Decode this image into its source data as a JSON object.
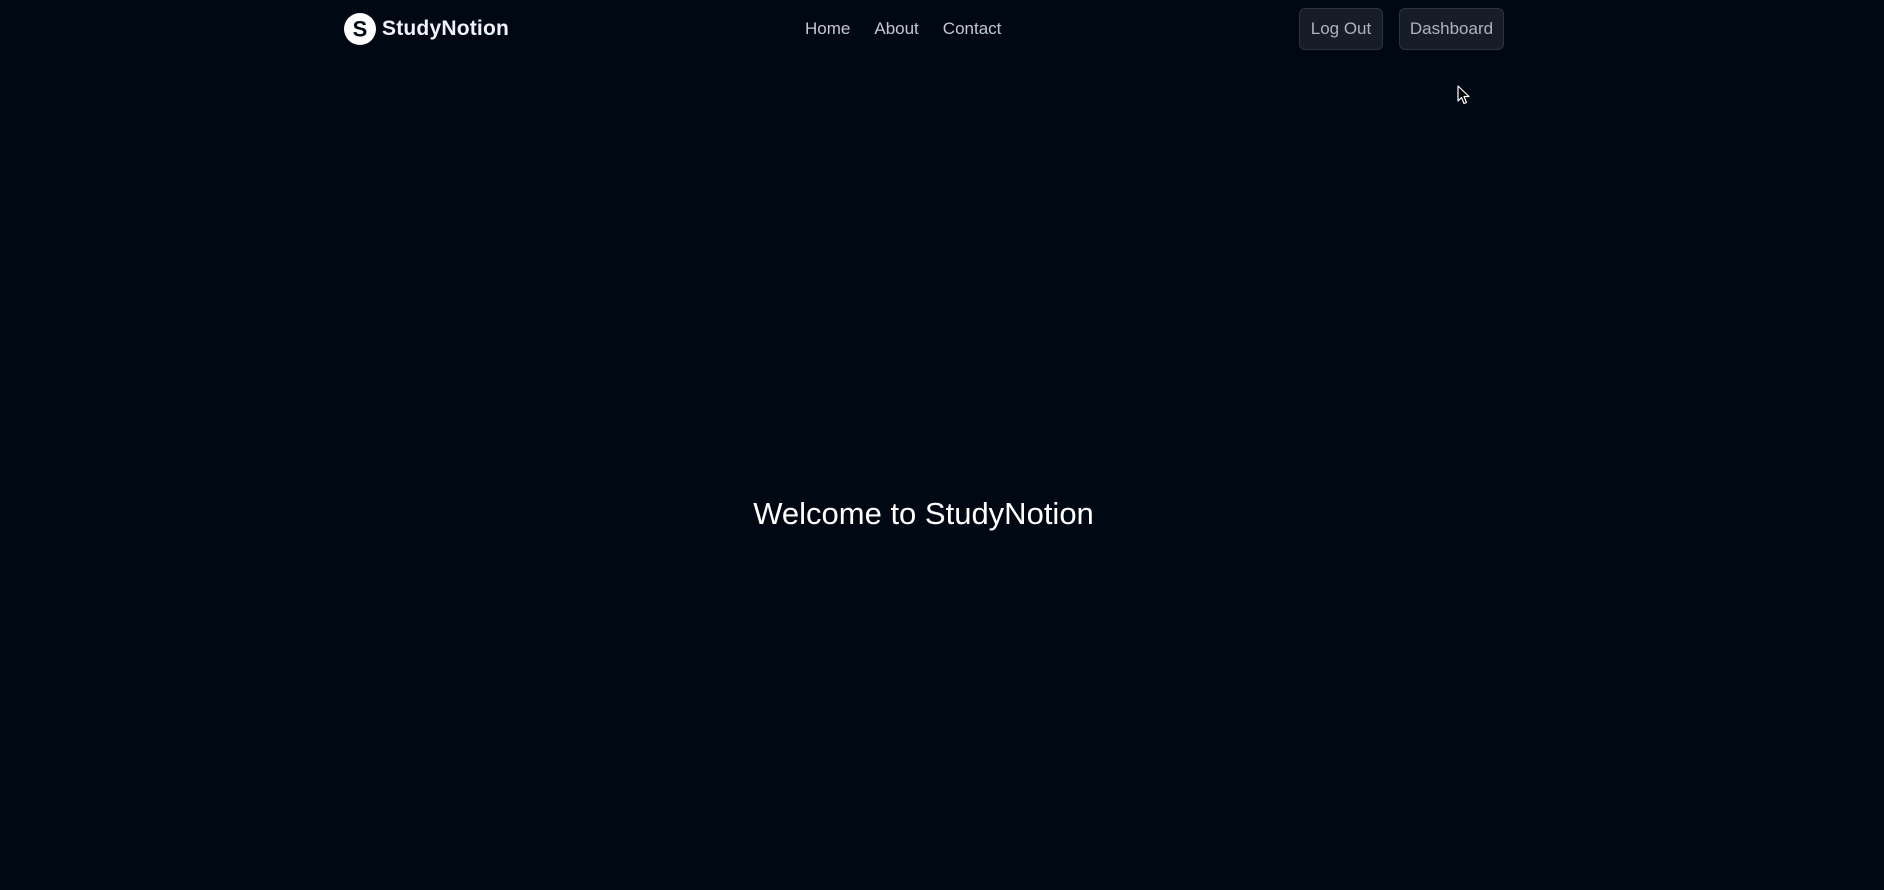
{
  "brand": {
    "name": "StudyNotion",
    "logo_icon": "studynotion-s-logo-icon"
  },
  "nav": {
    "links": [
      {
        "label": "Home"
      },
      {
        "label": "About"
      },
      {
        "label": "Contact"
      }
    ]
  },
  "actions": {
    "logout_label": "Log Out",
    "dashboard_label": "Dashboard"
  },
  "hero": {
    "title": "Welcome to StudyNotion"
  },
  "colors": {
    "background": "#000814",
    "button_bg": "#161d29",
    "button_border": "#2c333f",
    "nav_text": "#c5c7d4",
    "heading_text": "#ffffff"
  },
  "cursor_icon": "mouse-pointer-icon"
}
